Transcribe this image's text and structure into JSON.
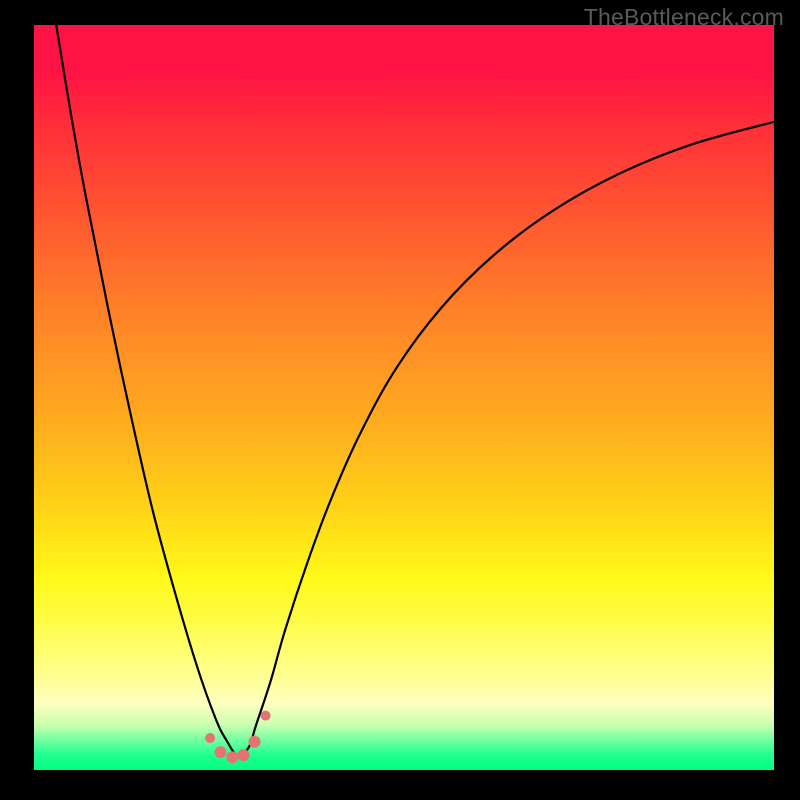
{
  "watermark": {
    "text": "TheBottleneck.com"
  },
  "colors": {
    "background": "#000000",
    "curve": "#000000",
    "marker_fill": "#e57373",
    "marker_stroke": "#c94f4f",
    "gradient_top": "#ff1244",
    "gradient_bottom": "#00ff80"
  },
  "chart_data": {
    "type": "line",
    "title": "",
    "xlabel": "",
    "ylabel": "",
    "xlim": [
      0,
      100
    ],
    "ylim": [
      0,
      100
    ],
    "series": [
      {
        "name": "bottleneck-curve",
        "x": [
          3,
          5,
          7,
          10,
          13,
          16,
          19,
          22,
          24.5,
          26,
          27.5,
          29,
          30,
          32,
          34,
          37,
          40,
          44,
          49,
          55,
          62,
          70,
          79,
          89,
          100
        ],
        "y": [
          100,
          88,
          77,
          62,
          48,
          35,
          24,
          14,
          7,
          4,
          2,
          3,
          6,
          12,
          19,
          28,
          36,
          45,
          54,
          62,
          69,
          75,
          80,
          84,
          87
        ]
      }
    ],
    "markers": [
      {
        "x": 23.8,
        "y": 4.3,
        "r": 5
      },
      {
        "x": 25.2,
        "y": 2.4,
        "r": 6
      },
      {
        "x": 26.8,
        "y": 1.7,
        "r": 6
      },
      {
        "x": 28.3,
        "y": 2.0,
        "r": 6
      },
      {
        "x": 29.8,
        "y": 3.8,
        "r": 6
      },
      {
        "x": 31.3,
        "y": 7.3,
        "r": 5
      }
    ]
  }
}
